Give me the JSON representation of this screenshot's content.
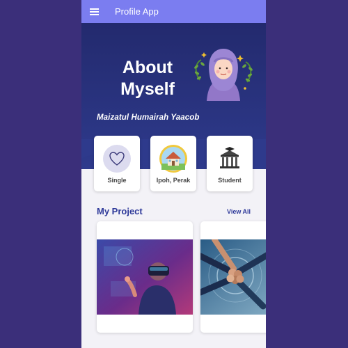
{
  "app": {
    "title": "Profile App"
  },
  "hero": {
    "title_line1": "About",
    "title_line2": "Myself",
    "name": "Maizatul Humairah Yaacob"
  },
  "info_cards": [
    {
      "label": "Single",
      "icon": "heart-icon"
    },
    {
      "label": "Ipoh, Perak",
      "icon": "house-icon"
    },
    {
      "label": "Student",
      "icon": "university-icon"
    }
  ],
  "projects": {
    "title": "My Project",
    "view_all": "View All"
  },
  "colors": {
    "appbar": "#7b7df0",
    "header": "#2a3380",
    "accent": "#2f3a9a",
    "page_bg": "#3b2f7a"
  }
}
